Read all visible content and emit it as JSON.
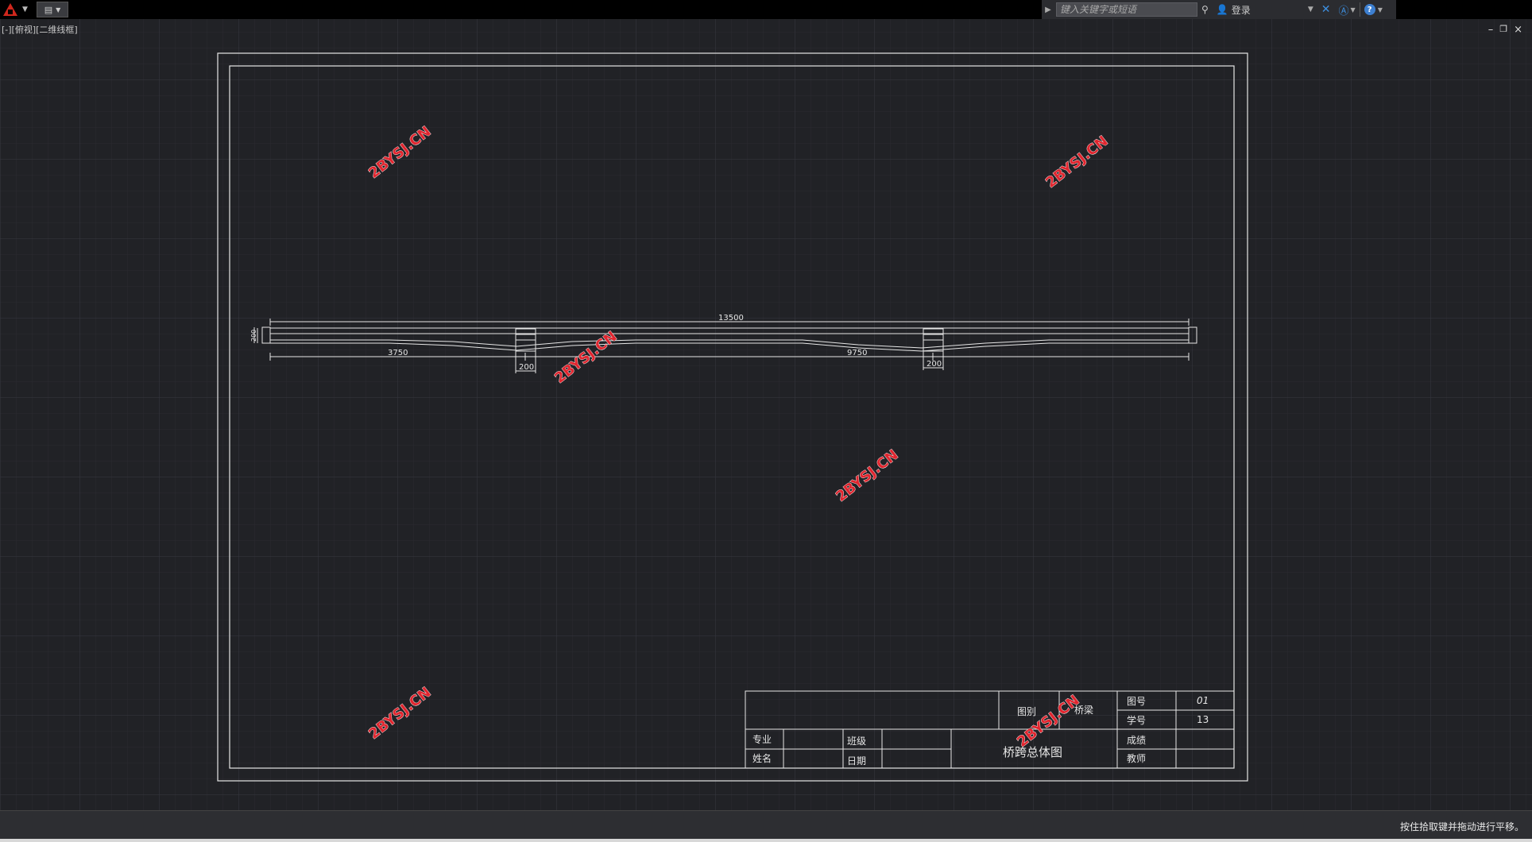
{
  "toolbar": {
    "search_placeholder": "键入关键字或短语",
    "login_label": "登录",
    "help_label": "?"
  },
  "viewport": {
    "label": "[-][俯视][二维线框]"
  },
  "window_controls": {
    "minimize": "–",
    "restore": "❐",
    "close": "×"
  },
  "drawing": {
    "dimensions": {
      "total": "13500",
      "left_span": "3750",
      "mid_span": "9750",
      "pier1_width": "200",
      "pier2_width": "200",
      "height": "200"
    },
    "watermark": "2BYSJ.CN",
    "title_block": {
      "drawing_class_label": "图别",
      "drawing_class_value": "桥梁",
      "drawing_no_label": "图号",
      "drawing_no_value": "01",
      "student_no_label": "学号",
      "student_no_value": "13",
      "major_label": "专业",
      "class_label": "班级",
      "name_label": "姓名",
      "date_label": "日期",
      "score_label": "成绩",
      "teacher_label": "教师",
      "drawing_title": "桥跨总体图"
    }
  },
  "status": {
    "message": "按住拾取键并拖动进行平移。"
  },
  "colors": {
    "background": "#212226",
    "grid_minor": "#2a2b2f",
    "grid_major": "#34363c",
    "lines": "#e6e6e6",
    "watermark": "#e0262f"
  }
}
